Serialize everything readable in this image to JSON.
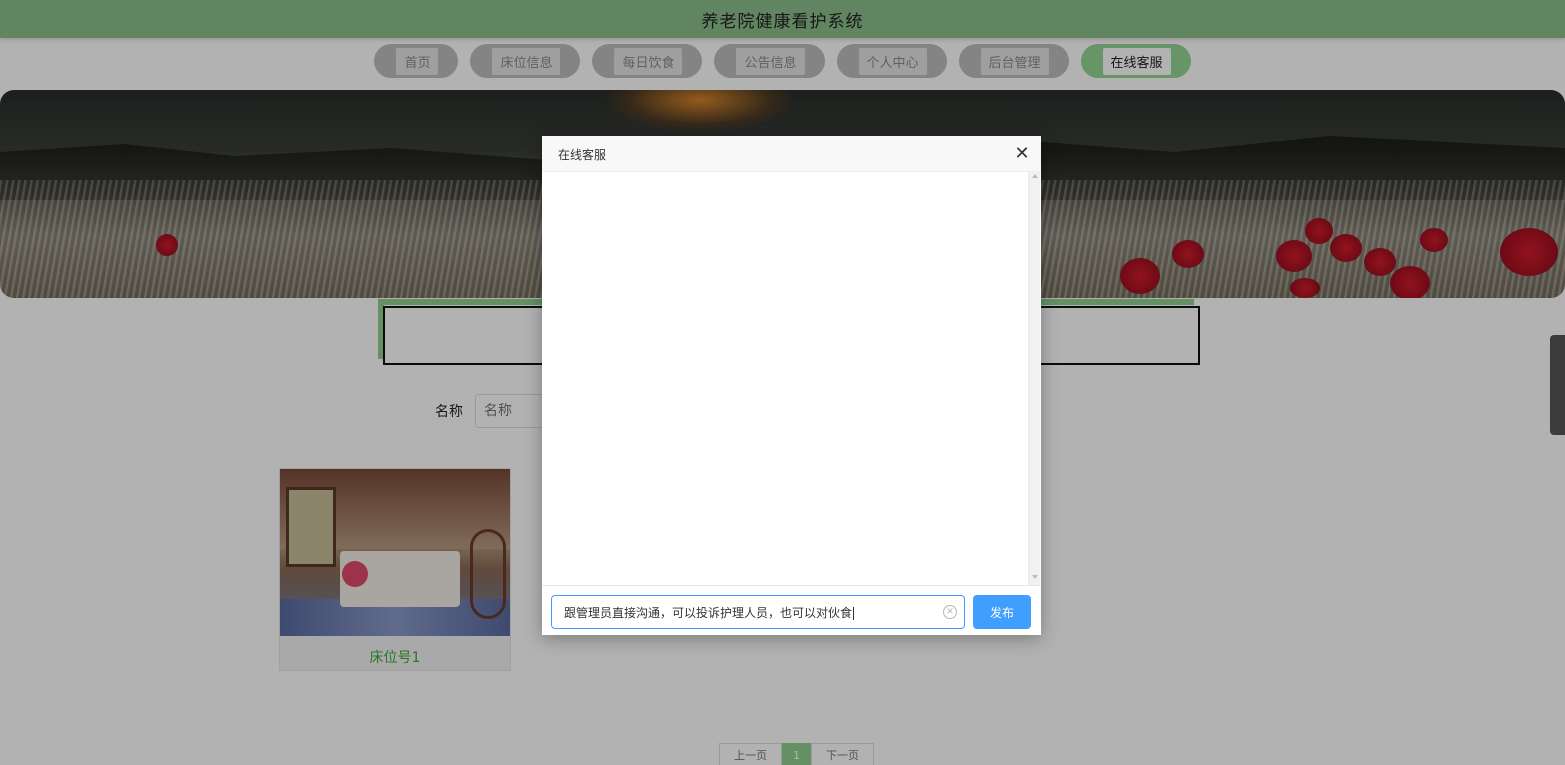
{
  "header": {
    "title": "养老院健康看护系统"
  },
  "nav": {
    "items": [
      {
        "label": "首页"
      },
      {
        "label": "床位信息"
      },
      {
        "label": "每日饮食"
      },
      {
        "label": "公告信息"
      },
      {
        "label": "个人中心"
      },
      {
        "label": "后台管理"
      },
      {
        "label": "在线客服"
      }
    ],
    "active_index": 6
  },
  "filter": {
    "label": "名称",
    "placeholder": "名称"
  },
  "cards": [
    {
      "title": "床位号1"
    }
  ],
  "pagination": {
    "prev": "上一页",
    "current": "1",
    "next": "下一页"
  },
  "dialog": {
    "title": "在线客服",
    "close_icon": "close-icon",
    "input_value": "跟管理员直接沟通，可以投诉护理人员，也可以对伙食",
    "send_label": "发布"
  },
  "colors": {
    "header_bg": "#8bbf8b",
    "nav_active": "#96d696",
    "accent_green": "#3aa83a",
    "primary_blue": "#409eff"
  }
}
